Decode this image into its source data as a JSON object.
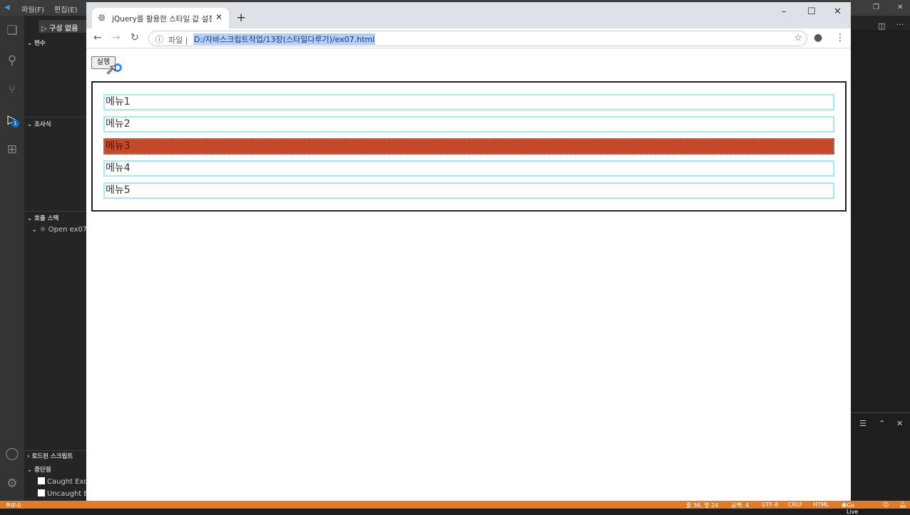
{
  "vscode": {
    "menu": [
      "파일(F)",
      "편집(E)"
    ],
    "run_config": "구성 없음",
    "sections": {
      "variables": "변수",
      "watch": "조사식",
      "call_stack": "호출 스택",
      "loaded_scripts": "로드된 스크립트",
      "breakpoints": "중단점"
    },
    "call_stack_item": "Open ex07",
    "breakpoint_items": [
      "Caught Exce",
      "Uncaught E"
    ],
    "debug_badge": "1",
    "status": {
      "errors": "0",
      "warnings": "0",
      "position": "줄 36, 열 24",
      "spaces": "공백: 4",
      "encoding": "UTF-8",
      "eol": "CRLF",
      "language": "HTML",
      "golive": "Go Live"
    },
    "accent": "#e07b28"
  },
  "browser": {
    "tab_title": "jQuery를 활용한 스타일 값 설정",
    "address_label": "파일",
    "url": "D:/자바스크립트작업/13장(스타일다루기)/ex07.html",
    "run_button": "실행",
    "menu_items": [
      {
        "label": "메뉴1",
        "selected": false
      },
      {
        "label": "메뉴2",
        "selected": false
      },
      {
        "label": "메뉴3",
        "selected": true
      },
      {
        "label": "메뉴4",
        "selected": false
      },
      {
        "label": "메뉴5",
        "selected": false
      }
    ],
    "selected_color": "#c24a2a"
  }
}
